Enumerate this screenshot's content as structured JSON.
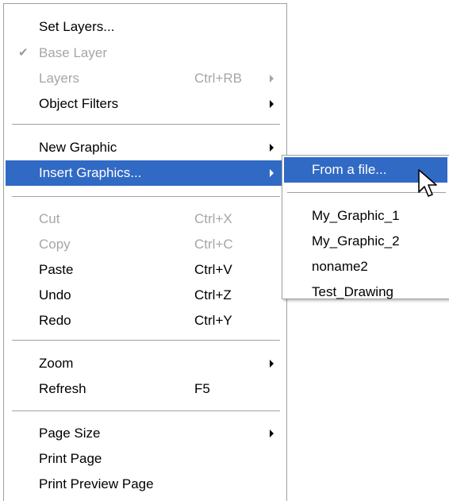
{
  "main_menu": {
    "set_layers": "Set Layers...",
    "base_layer": "Base Layer",
    "base_layer_check": "✔",
    "layers": "Layers",
    "layers_shortcut": "Ctrl+RB",
    "object_filters": "Object Filters",
    "new_graphic": "New Graphic",
    "insert_graphics": "Insert Graphics...",
    "cut": "Cut",
    "cut_shortcut": "Ctrl+X",
    "copy": "Copy",
    "copy_shortcut": "Ctrl+C",
    "paste": "Paste",
    "paste_shortcut": "Ctrl+V",
    "undo": "Undo",
    "undo_shortcut": "Ctrl+Z",
    "redo": "Redo",
    "redo_shortcut": "Ctrl+Y",
    "zoom": "Zoom",
    "refresh": "Refresh",
    "refresh_shortcut": "F5",
    "page_size": "Page Size",
    "print_page": "Print Page",
    "print_preview_page": "Print Preview Page"
  },
  "submenu": {
    "from_file": "From a file...",
    "graphics": [
      "My_Graphic_1",
      "My_Graphic_2",
      "noname2",
      "Test_Drawing"
    ]
  },
  "colors": {
    "highlight": "#316ac5",
    "disabled_text": "#a6a6a6",
    "border": "#a0a0a0"
  },
  "icons": {
    "check": "check-icon",
    "submenu_arrow": "submenu-arrow-icon",
    "cursor": "mouse-pointer-icon"
  }
}
